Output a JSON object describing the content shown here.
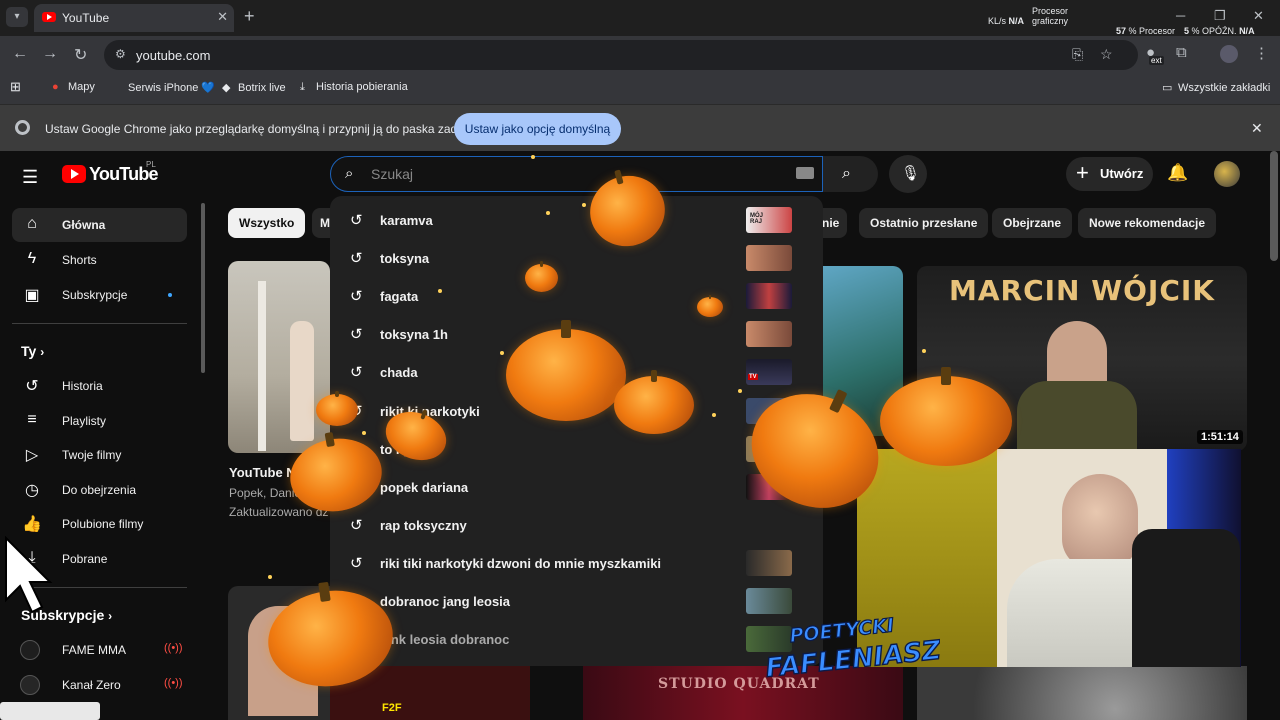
{
  "browser": {
    "tab_title": "YouTube",
    "url": "youtube.com",
    "stats": {
      "rate": "KL/s",
      "na1": "N/A",
      "gpu_label_top": "Procesor",
      "gpu_label_bottom": "graficzny",
      "cpu_value": "57",
      "cpu_unit": "% Procesor",
      "lat_value": "5",
      "lat_unit": "% OPÓŹN.",
      "na2": "N/A"
    },
    "ext_badge": "ext",
    "bookmarks": [
      {
        "label": "Mapy",
        "icon": "map-pin-icon"
      },
      {
        "label": "Serwis iPhone 💙",
        "icon": "apple-icon"
      },
      {
        "label": "Botrix live",
        "icon": "botrix-icon"
      },
      {
        "label": "Historia pobierania",
        "icon": "download-icon"
      }
    ],
    "all_bookmarks": "Wszystkie zakładki",
    "infobar": {
      "message": "Ustaw Google Chrome jako przeglądarkę domyślną i przypnij ją do paska zadań",
      "button": "Ustaw jako opcję domyślną"
    }
  },
  "youtube": {
    "logo_text": "YouTube",
    "country_code": "PL",
    "search_placeholder": "Szukaj",
    "create_label": "Utwórz",
    "sidebar": {
      "main": [
        {
          "label": "Główna",
          "icon": "home-icon"
        },
        {
          "label": "Shorts",
          "icon": "shorts-icon"
        },
        {
          "label": "Subskrypcje",
          "icon": "subscriptions-icon"
        }
      ],
      "you_heading": "Ty",
      "you": [
        {
          "label": "Historia",
          "icon": "history-icon"
        },
        {
          "label": "Playlisty",
          "icon": "playlist-icon"
        },
        {
          "label": "Twoje filmy",
          "icon": "your-videos-icon"
        },
        {
          "label": "Do obejrzenia",
          "icon": "watch-later-icon"
        },
        {
          "label": "Polubione filmy",
          "icon": "like-icon"
        },
        {
          "label": "Pobrane",
          "icon": "download-icon"
        }
      ],
      "subs_heading": "Subskrypcje",
      "subs": [
        {
          "label": "FAME MMA",
          "color": "#1e1e1e"
        },
        {
          "label": "Kanał Zero",
          "color": "#262626"
        }
      ]
    },
    "chips": [
      "Wszystko",
      "M",
      "nie",
      "Ostatnio przesłane",
      "Obejrzane",
      "Nowe rekomendacje"
    ],
    "videos": [
      {
        "title": "YouTube N",
        "channel": "Popek, Danie",
        "meta": "Zaktualizowano dz"
      },
      {
        "title": "MARCIN WÓJCIK",
        "duration": "1:51:14"
      }
    ],
    "suggestions": [
      "karamva",
      "toksyna",
      "fagata",
      "toksyna 1h",
      "chada",
      "rikit ki narkotyki",
      "to        ny",
      "popek dariana",
      "rap toksyczny",
      "riki tiki narkotyki dzwoni do mnie myszkamiki",
      "dobranoc jang leosia",
      "jank leosia dobranoc"
    ],
    "thumb_labels": [
      "MÓJ RAJ",
      "TV"
    ],
    "bottom_labels": [
      "F2F",
      "STUDIO QUADRAT"
    ]
  },
  "overlay": {
    "poet_line1": "POETYCKI",
    "poet_line2": "FAFLENIASZ"
  },
  "colors": {
    "accent_blue": "#1c62b9",
    "yt_red": "#ff0000",
    "pumpkin": "#f07a10",
    "infobar_btn": "#a8c7fa"
  }
}
